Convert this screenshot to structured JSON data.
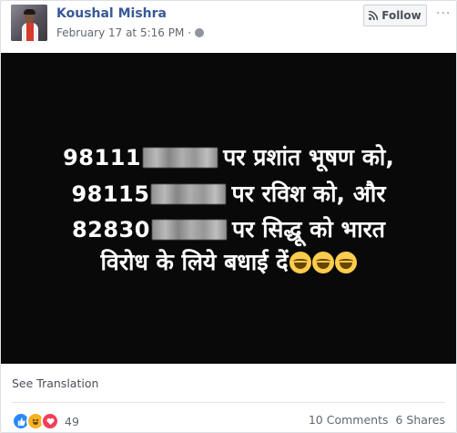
{
  "post": {
    "author": "Koushal Mishra",
    "timestamp": "February 17 at 5:16 PM",
    "meta_separator": "·",
    "follow_label": "Follow",
    "more_label": "···"
  },
  "image": {
    "lines": [
      {
        "prefix": "98111",
        "text": "पर प्रशांत भूषण को,"
      },
      {
        "prefix": "98115",
        "text": "पर रविश को, और"
      },
      {
        "prefix": "82830",
        "text": "पर सिद्धू को भारत"
      },
      {
        "prefix": "",
        "text": "विरोध के लिये बधाई दें"
      }
    ],
    "emoji_count": 3
  },
  "footer": {
    "see_translation": "See Translation",
    "reactions_count": "49",
    "comments": "10 Comments",
    "shares": "6 Shares",
    "reaction_icons": [
      "like-icon",
      "haha-icon",
      "love-icon"
    ]
  }
}
